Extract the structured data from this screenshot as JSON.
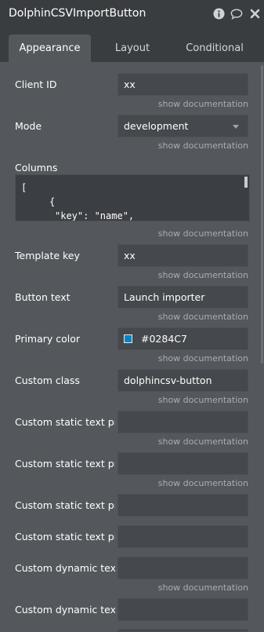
{
  "window": {
    "title": "DolphinCSVImportButton",
    "icons": [
      "info-icon",
      "comment-icon",
      "close-icon"
    ]
  },
  "tabs": [
    {
      "label": "Appearance",
      "active": true
    },
    {
      "label": "Layout",
      "active": false
    },
    {
      "label": "Conditional",
      "active": false
    }
  ],
  "doc_link": "show documentation",
  "fields": {
    "client_id": {
      "label": "Client ID",
      "value": "xx"
    },
    "mode": {
      "label": "Mode",
      "value": "development"
    },
    "columns": {
      "label": "Columns",
      "lines": [
        "[",
        "{",
        "\"key\": \"name\","
      ]
    },
    "template_key": {
      "label": "Template key",
      "value": "xx"
    },
    "button_text": {
      "label": "Button text",
      "value": "Launch importer"
    },
    "primary_color": {
      "label": "Primary color",
      "value": "#0284C7",
      "swatch_color": "#0284C7"
    },
    "custom_class": {
      "label": "Custom class",
      "value": "dolphincsv-button"
    },
    "custom_static_1": {
      "label": "Custom static text pro",
      "value": ""
    },
    "custom_static_2": {
      "label": "Custom static text pro",
      "value": ""
    },
    "custom_static_3": {
      "label": "Custom static text pro",
      "value": ""
    },
    "custom_static_4": {
      "label": "Custom static text pro",
      "value": ""
    },
    "custom_dynamic_1": {
      "label": "Custom dynamic text",
      "value": ""
    },
    "custom_dynamic_2": {
      "label": "Custom dynamic text",
      "value": ""
    }
  },
  "colors": {
    "panel_bg": "#54585d",
    "header_bg": "#3a3d40",
    "input_bg": "#45484c",
    "accent": "#0284C7"
  }
}
